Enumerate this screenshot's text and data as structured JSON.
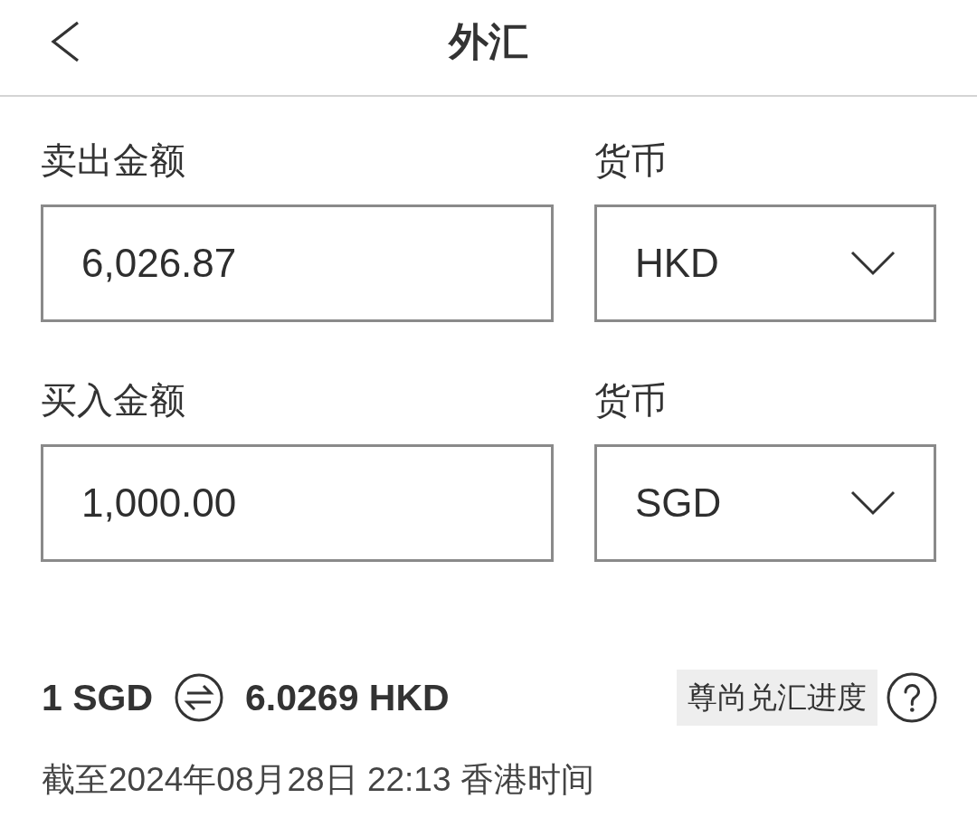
{
  "header": {
    "title": "外汇"
  },
  "exchange_fields": [
    {
      "amount_label": "卖出金额",
      "amount_value": "6,026.87",
      "currency_label": "货币",
      "currency_value": "HKD"
    },
    {
      "amount_label": "买入金额",
      "amount_value": "1,000.00",
      "currency_label": "货币",
      "currency_value": "SGD"
    }
  ],
  "rate": {
    "base": "1 SGD",
    "quote": "6.0269 HKD"
  },
  "premium_progress_button": {
    "label": "尊尚兑汇进度"
  },
  "timestamp": "截至2024年08月28日 22:13 香港时间"
}
